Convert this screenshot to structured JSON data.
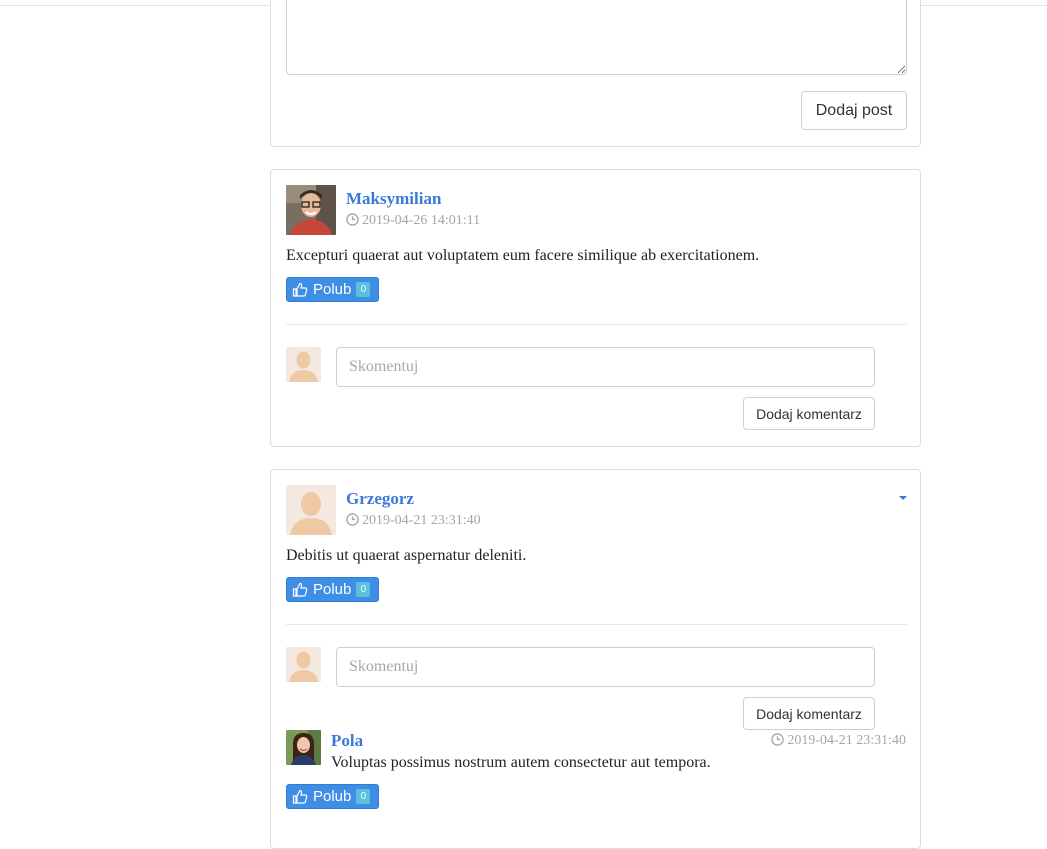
{
  "new_post": {
    "textarea_value": "",
    "submit_label": "Dodaj post"
  },
  "posts": [
    {
      "author": "Maksymilian",
      "timestamp": "2019-04-26 14:01:11",
      "text": "Excepturi quaerat aut voluptatem eum facere similique ab exercitationem.",
      "like_label": "Polub",
      "like_count": "0",
      "comment_placeholder": "Skomentuj",
      "comment_submit_label": "Dodaj komentarz"
    },
    {
      "author": "Grzegorz",
      "timestamp": "2019-04-21 23:31:40",
      "text": "Debitis ut quaerat aspernatur deleniti.",
      "like_label": "Polub",
      "like_count": "0",
      "comment_placeholder": "Skomentuj",
      "comment_submit_label": "Dodaj komentarz",
      "comments": [
        {
          "author": "Pola",
          "timestamp": "2019-04-21 23:31:40",
          "text": "Voluptas possimus nostrum autem consectetur aut tempora.",
          "like_label": "Polub",
          "like_count": "0"
        }
      ]
    }
  ],
  "colors": {
    "link": "#3b78d8",
    "like_button": "#3f8ee5",
    "badge": "#5bc0de",
    "muted": "#a5a5a5"
  },
  "icons": [
    "clock-icon",
    "thumbs-up-icon",
    "caret-down-icon",
    "avatar-placeholder-icon"
  ]
}
